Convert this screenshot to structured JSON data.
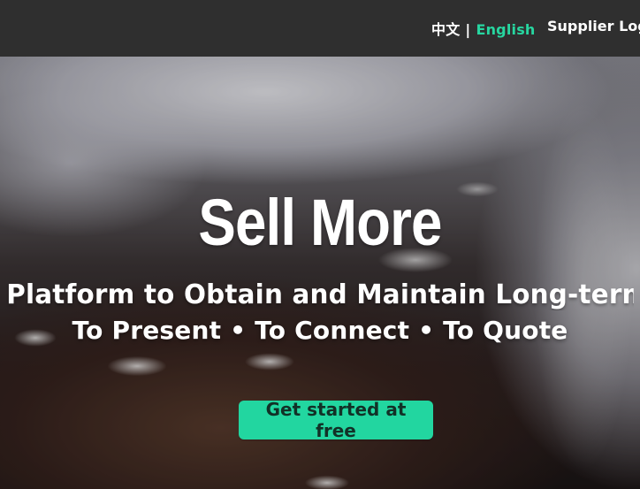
{
  "header": {
    "languages": {
      "zh_label": "中文",
      "separator": "|",
      "en_label": "English",
      "active": "English",
      "active_color": "#27d6a0"
    },
    "supplier_login_label": "Supplier Logi"
  },
  "hero": {
    "title": "Sell More",
    "subtitle_line1": "Platform to Obtain and Maintain Long-term B",
    "subtitle_line2": "To Present • To Connect • To Quote",
    "cta_label": "Get started at free",
    "cta_color": "#22d6a0"
  }
}
